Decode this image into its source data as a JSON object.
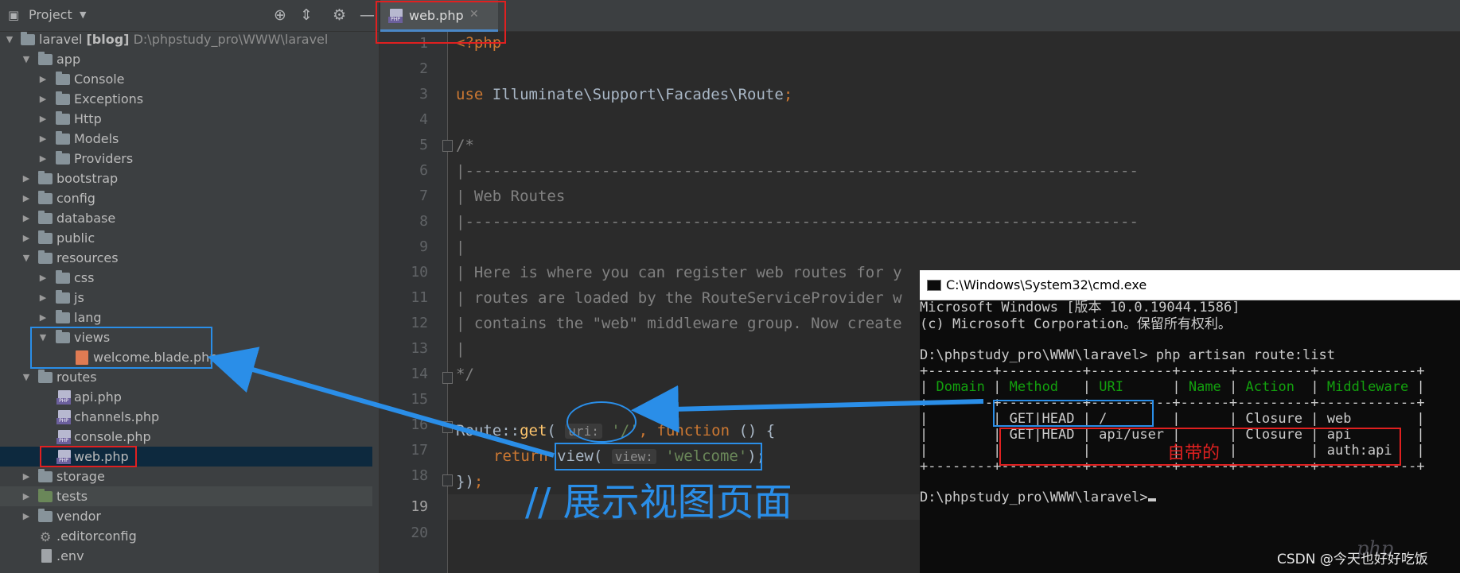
{
  "project_panel": {
    "title": "Project",
    "tree": [
      {
        "label": "laravel",
        "bold": "[blog]",
        "path": "D:\\phpstudy_pro\\WWW\\laravel"
      },
      {
        "label": "app"
      },
      {
        "label": "Console"
      },
      {
        "label": "Exceptions"
      },
      {
        "label": "Http"
      },
      {
        "label": "Models"
      },
      {
        "label": "Providers"
      },
      {
        "label": "bootstrap"
      },
      {
        "label": "config"
      },
      {
        "label": "database"
      },
      {
        "label": "public"
      },
      {
        "label": "resources"
      },
      {
        "label": "css"
      },
      {
        "label": "js"
      },
      {
        "label": "lang"
      },
      {
        "label": "views"
      },
      {
        "label": "welcome.blade.php"
      },
      {
        "label": "routes"
      },
      {
        "label": "api.php"
      },
      {
        "label": "channels.php"
      },
      {
        "label": "console.php"
      },
      {
        "label": "web.php"
      },
      {
        "label": "storage"
      },
      {
        "label": "tests"
      },
      {
        "label": "vendor"
      },
      {
        "label": ".editorconfig"
      },
      {
        "label": ".env"
      }
    ]
  },
  "editor": {
    "tab": "web.php",
    "line_numbers": [
      "1",
      "2",
      "3",
      "4",
      "5",
      "6",
      "7",
      "8",
      "9",
      "10",
      "11",
      "12",
      "13",
      "14",
      "15",
      "16",
      "17",
      "18",
      "19",
      "20"
    ],
    "code": {
      "l1": "<?php",
      "l3_use": "use",
      "l3_rest": " Illuminate\\Support\\Facades\\Route",
      "l3_semi": ";",
      "l5": "/*",
      "l6": "|--------------------------------------------------------------------------",
      "l7": "| Web Routes",
      "l8": "|--------------------------------------------------------------------------",
      "l9": "|",
      "l10": "| Here is where you can register web routes for y",
      "l11": "| routes are loaded by the RouteServiceProvider w",
      "l12": "| contains the \"web\" middleware group. Now create",
      "l13": "|",
      "l14": "*/",
      "l16_a": "Route::",
      "l16_get": "get",
      "l16_paren": "( ",
      "l16_hint": "uri:",
      "l16_str": "'/'",
      "l16_comma": ", ",
      "l16_function": "function",
      "l16_end": " () {",
      "l17_return": "return",
      "l17_view": " view( ",
      "l17_hint": "view:",
      "l17_str": "'welcome'",
      "l17_end": ");",
      "l18_a": "})",
      "l18_semi": ";"
    }
  },
  "cmd": {
    "title": "C:\\Windows\\System32\\cmd.exe",
    "lines": [
      "Microsoft Windows [版本 10.0.19044.1586]",
      "(c) Microsoft Corporation。保留所有权利。",
      "",
      "D:\\phpstudy_pro\\WWW\\laravel> php artisan route:list",
      "+--------+----------+----------+------+---------+------------+",
      "| Domain | Method   | URI      | Name | Action  | Middleware |",
      "+--------+----------+----------+------+---------+------------+",
      "|        | GET|HEAD | /        |      | Closure | web        |",
      "|        | GET|HEAD | api/user |      | Closure | api        |",
      "|        |          |          |      |         | auth:api   |",
      "+--------+----------+----------+------+---------+------------+",
      "",
      "D:\\phpstudy_pro\\WWW\\laravel>"
    ],
    "header_cells": [
      "Domain",
      "Method",
      "URI",
      "Name",
      "Action",
      "Middleware"
    ]
  },
  "annotations": {
    "builtin_label": "自带的",
    "note": "// 展示视图页面",
    "watermark": "CSDN @今天也好好吃饭",
    "php_logo": "php"
  }
}
